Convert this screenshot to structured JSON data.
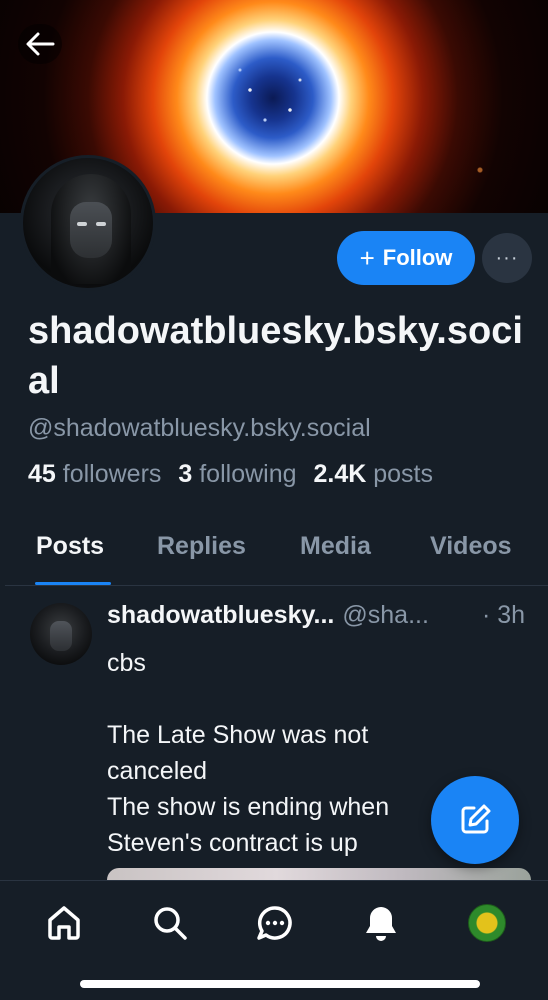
{
  "profile": {
    "display_name": "shadowatbluesky.bsky.social",
    "handle": "@shadowatbluesky.bsky.social",
    "followers_count": "45",
    "followers_label": "followers",
    "following_count": "3",
    "following_label": "following",
    "posts_count": "2.4K",
    "posts_label": "posts"
  },
  "actions": {
    "follow_label": "Follow",
    "more_label": "···"
  },
  "tabs": [
    {
      "label": "Posts",
      "active": true
    },
    {
      "label": "Replies",
      "active": false
    },
    {
      "label": "Media",
      "active": false
    },
    {
      "label": "Videos",
      "active": false
    }
  ],
  "post": {
    "author": "shadowatbluesky...",
    "handle": "@sha...",
    "time": "· 3h",
    "lines": [
      "cbs",
      "",
      "The Late Show was not canceled",
      "The show is ending when Steven's contract is up"
    ]
  },
  "icons": {
    "back": "arrow-left-icon",
    "compose": "compose-icon",
    "nav": [
      "home-icon",
      "search-icon",
      "chat-icon",
      "bell-icon",
      "profile-avatar"
    ]
  },
  "colors": {
    "accent": "#1a84f5",
    "background": "#161e27",
    "muted_text": "#8997a7"
  }
}
